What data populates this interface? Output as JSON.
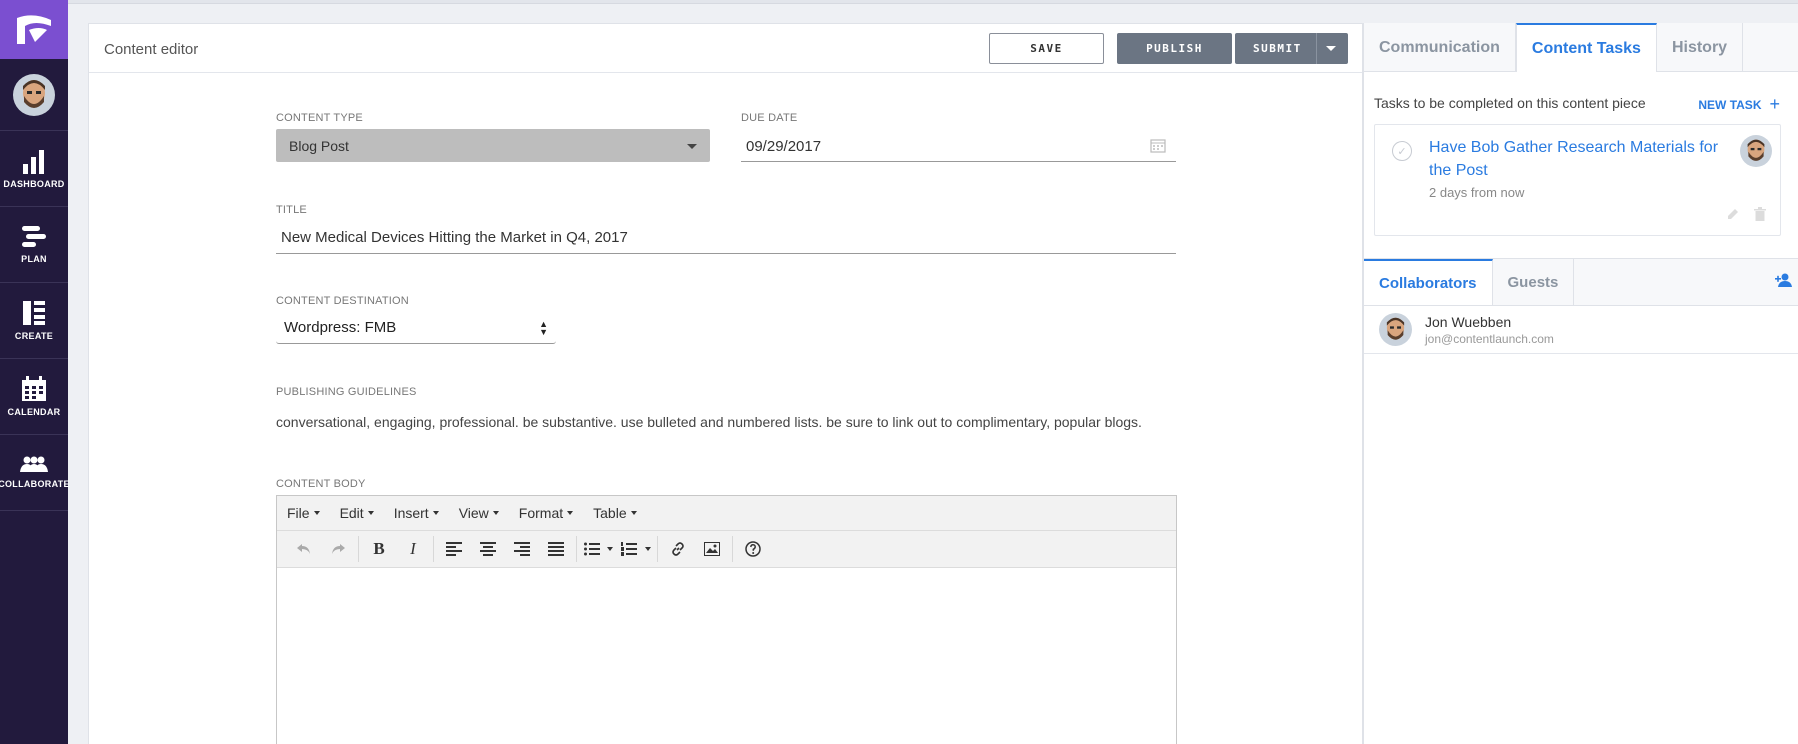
{
  "nav": {
    "items": [
      {
        "label": "DASHBOARD",
        "icon": "bar-chart-icon"
      },
      {
        "label": "PLAN",
        "icon": "plan-bars-icon"
      },
      {
        "label": "CREATE",
        "icon": "create-layout-icon"
      },
      {
        "label": "CALENDAR",
        "icon": "calendar-icon"
      },
      {
        "label": "COLLABORATE",
        "icon": "people-icon"
      }
    ]
  },
  "editor": {
    "title": "Content editor",
    "save_label": "SAVE",
    "publish_label": "PUBLISH",
    "submit_label": "SUBMIT",
    "content_type_label": "CONTENT TYPE",
    "content_type_value": "Blog Post",
    "due_date_label": "DUE DATE",
    "due_date_value": "09/29/2017",
    "title_label": "TITLE",
    "title_value": "New Medical Devices Hitting the Market in Q4, 2017",
    "destination_label": "CONTENT DESTINATION",
    "destination_value": "Wordpress: FMB",
    "guidelines_label": "PUBLISHING GUIDELINES",
    "guidelines_text": "conversational, engaging, professional. be substantive. use bulleted and numbered lists. be sure to link out to complimentary, popular blogs.",
    "body_label": "CONTENT BODY",
    "menus": [
      "File",
      "Edit",
      "Insert",
      "View",
      "Format",
      "Table"
    ]
  },
  "panel": {
    "tabs": [
      "Communication",
      "Content Tasks",
      "History"
    ],
    "active_tab": "Content Tasks",
    "tasks_heading": "Tasks to be completed on this content piece",
    "new_task_label": "NEW TASK",
    "task": {
      "title": "Have Bob Gather Research Materials for the Post",
      "due": "2 days from now"
    },
    "collab_tabs": [
      "Collaborators",
      "Guests"
    ],
    "collaborator": {
      "name": "Jon Wuebben",
      "email": "jon@contentlaunch.com"
    }
  },
  "colors": {
    "nav_bg": "#221a3d",
    "logo_bg": "#7b4fd0",
    "accent": "#2a7be0",
    "rail_active": "#6a3fc0"
  }
}
